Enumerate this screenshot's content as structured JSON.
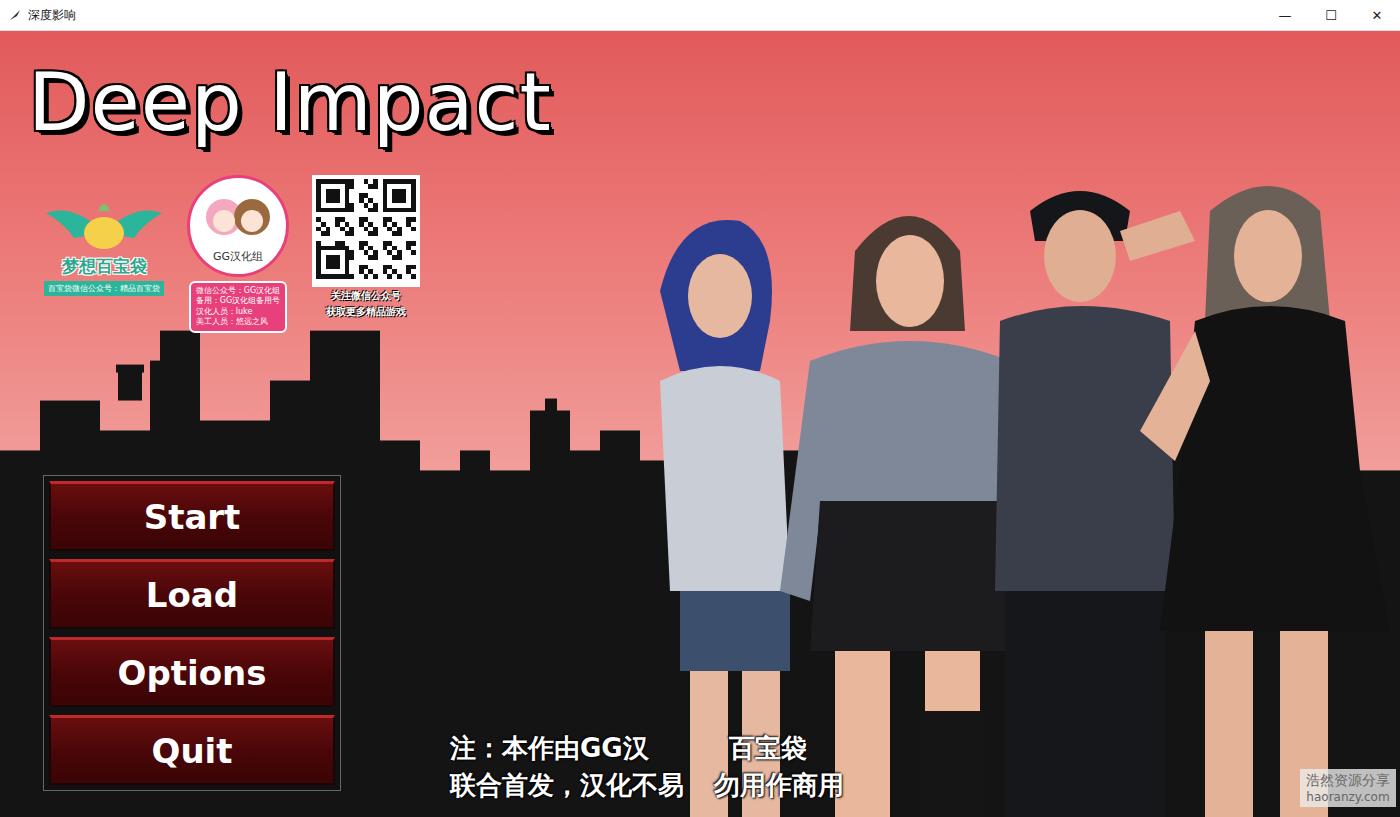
{
  "window": {
    "title": "深度影响",
    "controls": [
      "—",
      "☐",
      "✕"
    ]
  },
  "game": {
    "title": "Deep Impact"
  },
  "logos": {
    "baibaodai": {
      "name": "梦想百宝袋",
      "caption": "百宝袋微信公众号：精品百宝袋"
    },
    "gg": {
      "name": "GG汉化组",
      "lines": [
        "微信公众号：GG汉化组",
        "备用：GG汉化组备用号",
        "汉化人员：luke",
        "美工人员：悠远之风"
      ]
    },
    "qr": {
      "lines": [
        "关注微信公众号",
        "获取更多精品游戏"
      ]
    }
  },
  "menu": [
    {
      "label": "Start"
    },
    {
      "label": "Load"
    },
    {
      "label": "Options"
    },
    {
      "label": "Quit"
    }
  ],
  "note": [
    [
      "注：本作由GG汉",
      "百宝袋"
    ],
    [
      "联合首发，汉化不易",
      "勿用作商用"
    ]
  ],
  "watermark": {
    "name": "浩然资源分享",
    "url": "haoranzy.com"
  }
}
